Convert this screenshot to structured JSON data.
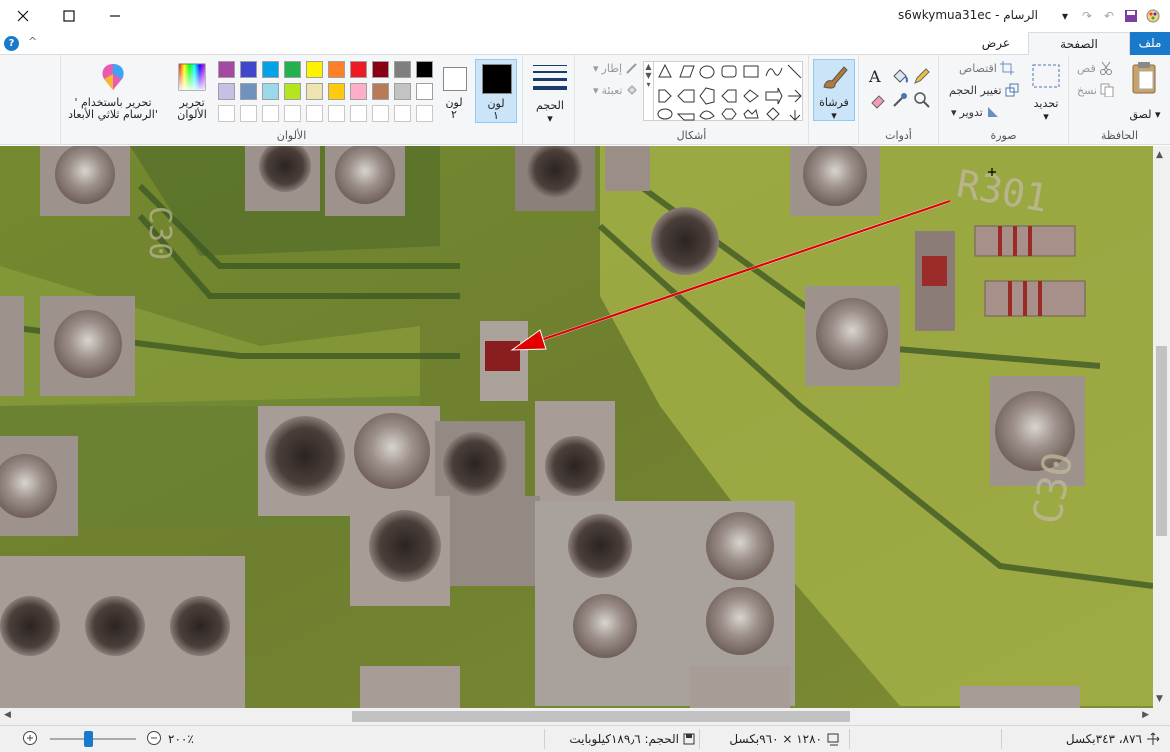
{
  "window": {
    "title": "s6wkymua31ec - الرسام",
    "minimize_icon": "minimize-icon",
    "maximize_icon": "maximize-icon",
    "close_icon": "close-icon"
  },
  "tabs": {
    "file": "ملف",
    "home": "الصفحة الرئيسية",
    "view": "عرض"
  },
  "clipboard": {
    "paste": "لصق",
    "cut": "قص",
    "copy": "نسخ",
    "group": "الحافظة"
  },
  "image": {
    "select": "تحديد",
    "crop": "اقتصاص",
    "resize": "تغيير الحجم",
    "rotate": "تدوير",
    "group": "صورة"
  },
  "tools": {
    "group": "أدوات"
  },
  "brushes": {
    "label": "فرشاة"
  },
  "shapes": {
    "outline": "إطار",
    "fill": "تعبئة",
    "group": "أشكال"
  },
  "size": {
    "label": "الحجم"
  },
  "colors": {
    "color1_label": "لون",
    "color1_num": "١",
    "color2_label": "لون",
    "color2_num": "٢",
    "edit_colors": "تحرير الألوان",
    "edit_3d": "تحرير باستخدام ' الرسام ثلاثي الأبعاد'",
    "group": "الألوان",
    "color1": "#000000",
    "color2": "#ffffff",
    "palette_row1": [
      "#000000",
      "#7f7f7f",
      "#880015",
      "#ed1c24",
      "#ff7f27",
      "#fff200",
      "#22b14c",
      "#00a2e8",
      "#3f48cc",
      "#a349a4"
    ],
    "palette_row2": [
      "#ffffff",
      "#c3c3c3",
      "#b97a57",
      "#ffaec9",
      "#ffc90e",
      "#efe4b0",
      "#b5e61d",
      "#99d9ea",
      "#7092be",
      "#c8bfe7"
    ]
  },
  "canvas_text": {
    "label_top": "R301",
    "label_right": "C30",
    "label_left": "C30"
  },
  "status": {
    "cursor_pos": "٨٧٦، ٣٤٣بكسل",
    "selection_size": "",
    "image_size": "١٢٨٠ × ٩٦٠بكسل",
    "file_size": "الحجم: ١٨٩٫٦كيلوبايت",
    "zoom": "٢٠٠٪"
  }
}
